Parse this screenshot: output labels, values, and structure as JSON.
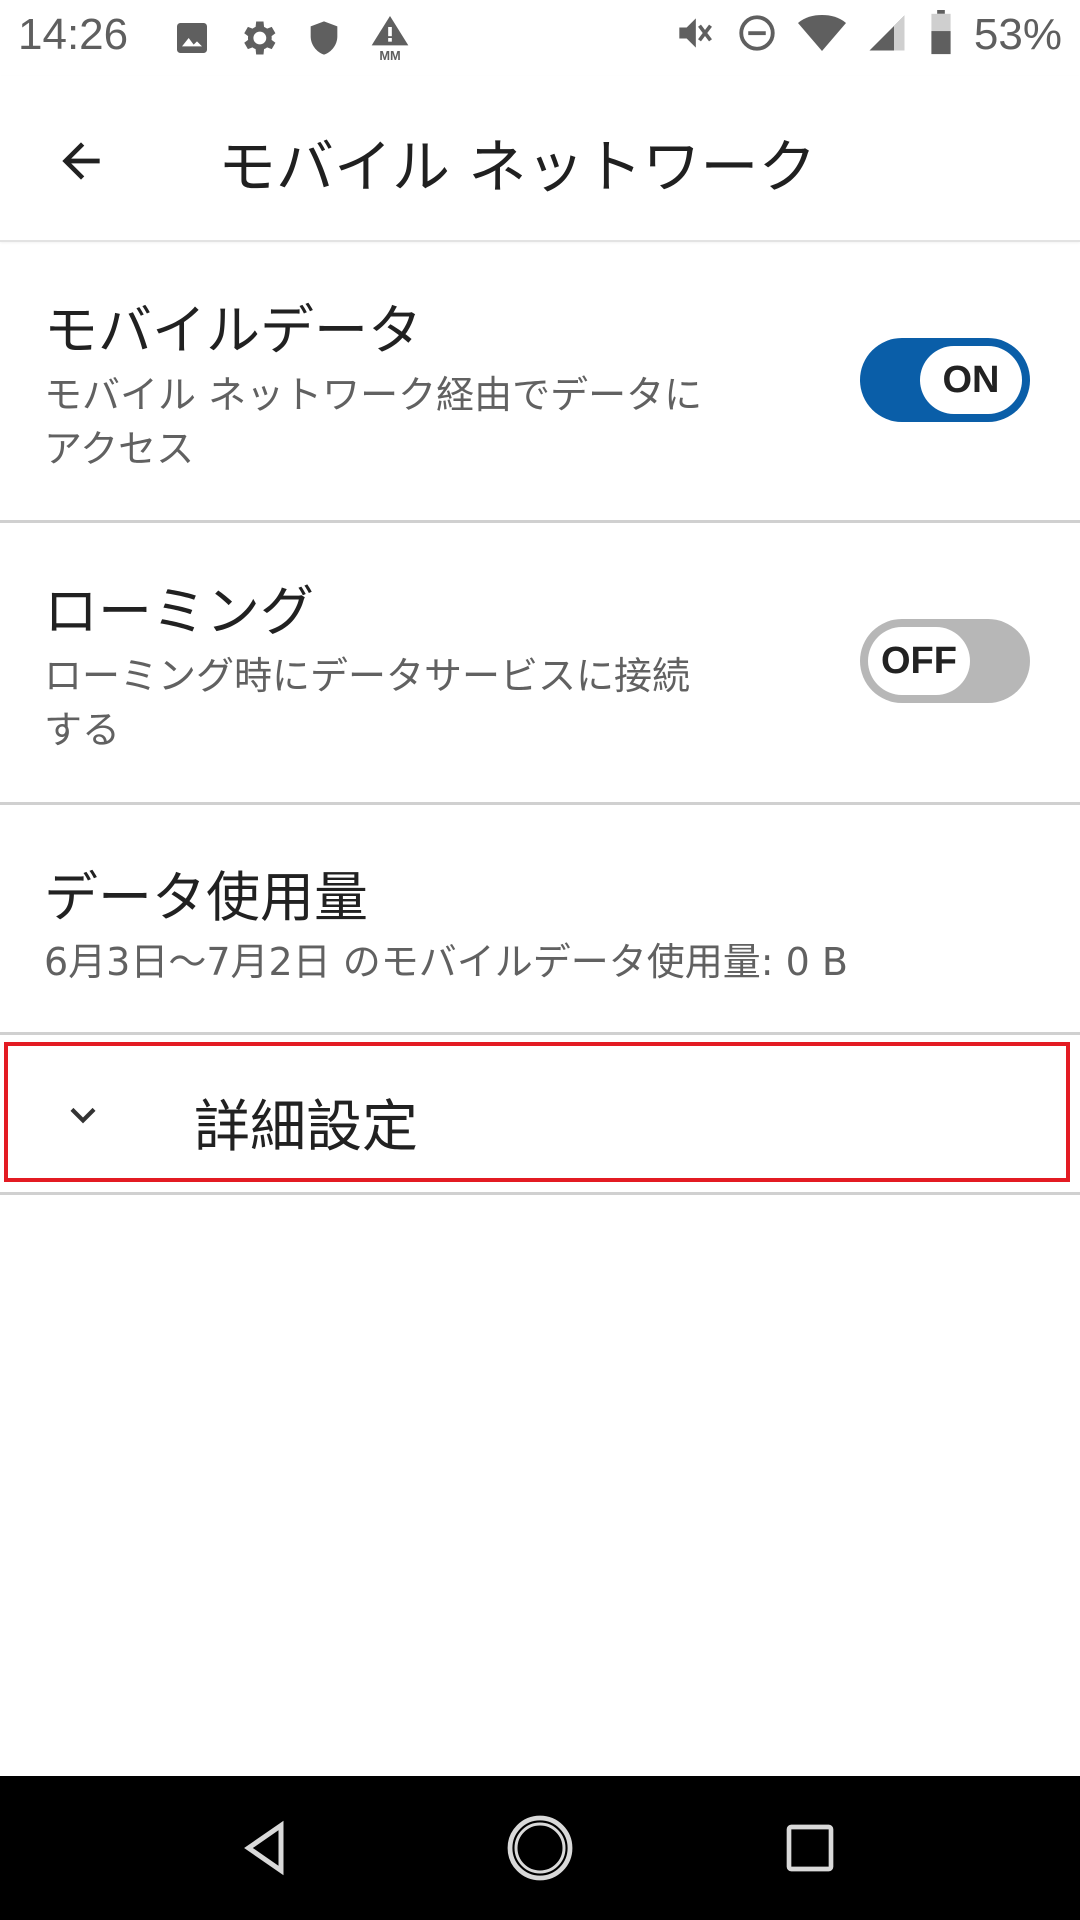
{
  "status_bar": {
    "time": "14:26",
    "battery_percent": "53%",
    "left_icons": [
      "image-icon",
      "gear-icon",
      "shield-icon",
      "warning-mm-icon"
    ],
    "right_icons": [
      "mute-icon",
      "dnd-icon",
      "wifi-icon",
      "signal-icon",
      "battery-icon"
    ],
    "mm_label": "MM"
  },
  "app_bar": {
    "title": "モバイル ネットワーク"
  },
  "preferences": {
    "mobile_data": {
      "title": "モバイルデータ",
      "summary_line1": "モバイル ネットワーク経由でデータに",
      "summary_line2": "アクセス",
      "toggle_label": "ON",
      "toggle_state": "on"
    },
    "roaming": {
      "title": "ローミング",
      "summary_line1": "ローミング時にデータサービスに接続",
      "summary_line2": "する",
      "toggle_label": "OFF",
      "toggle_state": "off"
    },
    "data_usage": {
      "title": "データ使用量",
      "summary": "6月3日〜7月2日 のモバイルデータ使用量: 0 B"
    }
  },
  "advanced": {
    "label": "詳細設定"
  },
  "colors": {
    "toggle_on": "#0a5ea8",
    "toggle_off": "#b7b7b7",
    "highlight": "#e31b23"
  }
}
